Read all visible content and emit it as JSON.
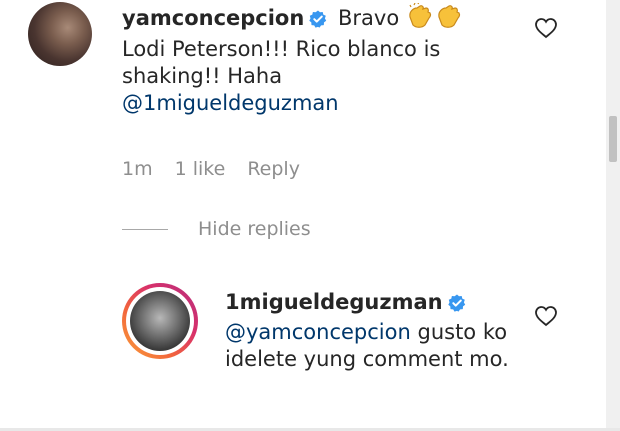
{
  "comment": {
    "username": "yamconcepcion",
    "text_lead": "Bravo",
    "emoji": "clapping-hands-emoji",
    "text_rest": "Lodi Peterson!!! Rico blanco is shaking!! Haha",
    "mention": "@1migueldeguzman",
    "time": "1m",
    "likes": "1 like",
    "reply_label": "Reply"
  },
  "hide_replies_label": "Hide replies",
  "reply": {
    "username": "1migueldeguzman",
    "mention": "@yamconcepcion",
    "text": "gusto ko idelete yung comment mo."
  },
  "colors": {
    "verified": "#3897f0",
    "mention": "#00376b",
    "meta": "#8e8e8e",
    "story_ring": "#d8306a"
  }
}
